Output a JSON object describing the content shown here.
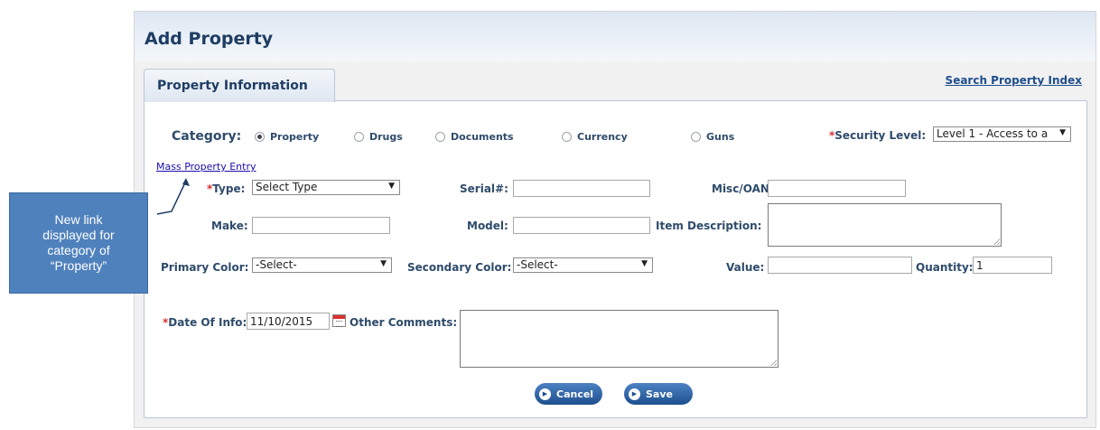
{
  "page": {
    "title": "Add Property"
  },
  "tab": {
    "label": "Property Information"
  },
  "search_link": "Search Property Index",
  "category": {
    "label": "Category:",
    "options": [
      "Property",
      "Drugs",
      "Documents",
      "Currency",
      "Guns"
    ],
    "selected": "Property"
  },
  "security": {
    "asterisk": "*",
    "label": "Security Level:",
    "value": "Level 1 - Access to a"
  },
  "mass_link": "Mass Property Entry",
  "fields": {
    "type": {
      "asterisk": "*",
      "label": "Type:",
      "value": "Select Type"
    },
    "serial": {
      "label": "Serial#:",
      "value": ""
    },
    "misc": {
      "label": "Misc/OAN:",
      "value": ""
    },
    "make": {
      "label": "Make:",
      "value": ""
    },
    "model": {
      "label": "Model:",
      "value": ""
    },
    "item_desc": {
      "label": "Item Description:",
      "value": ""
    },
    "primary_color": {
      "label": "Primary Color:",
      "value": "-Select-"
    },
    "secondary_color": {
      "label": "Secondary Color:",
      "value": "-Select-"
    },
    "value": {
      "label": "Value:",
      "value": ""
    },
    "quantity": {
      "label": "Quantity:",
      "value": "1"
    },
    "date": {
      "asterisk": "*",
      "label": "Date Of Info:",
      "value": "11/10/2015"
    },
    "other_comments": {
      "label": "Other Comments:",
      "value": ""
    }
  },
  "buttons": {
    "cancel": "Cancel",
    "save": "Save"
  },
  "callout": {
    "lines": [
      "New link",
      "displayed for",
      "category of",
      "“Property”"
    ]
  },
  "icons": {
    "dropdown": "chevron-down-icon",
    "calendar": "calendar-icon",
    "button": "play-circle-icon"
  },
  "colors": {
    "accent": "#1f3d63",
    "required": "#d9302b",
    "callout": "#4f81bd",
    "button": "#2a5f9e"
  }
}
